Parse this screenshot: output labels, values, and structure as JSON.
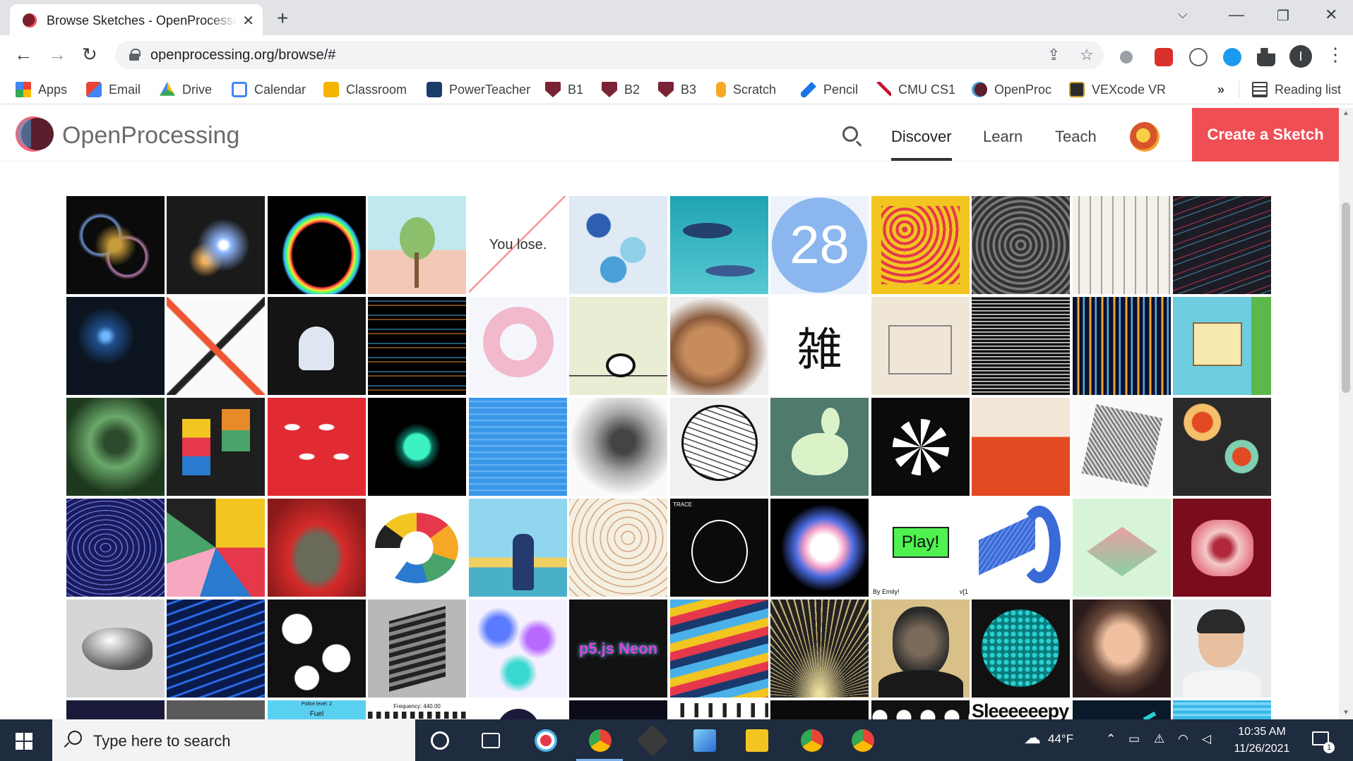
{
  "browser": {
    "tab_title": "Browse Sketches - OpenProcessing",
    "url": "openprocessing.org/browse/#",
    "profile_initial": "I"
  },
  "bookmarks": [
    {
      "label": "Apps",
      "icon": "apps-grid-icon"
    },
    {
      "label": "Email",
      "icon": "gmail-icon"
    },
    {
      "label": "Drive",
      "icon": "drive-icon"
    },
    {
      "label": "Calendar",
      "icon": "calendar-icon"
    },
    {
      "label": "Classroom",
      "icon": "classroom-icon"
    },
    {
      "label": "PowerTeacher",
      "icon": "sis-icon"
    },
    {
      "label": "B1",
      "icon": "shield-icon"
    },
    {
      "label": "B2",
      "icon": "shield-icon"
    },
    {
      "label": "B3",
      "icon": "shield-icon"
    },
    {
      "label": "Scratch",
      "icon": "scratch-icon"
    },
    {
      "label": "Pencil",
      "icon": "pencil-icon"
    },
    {
      "label": "CMU CS1",
      "icon": "cmu-icon"
    },
    {
      "label": "OpenProc",
      "icon": "openprocessing-icon"
    },
    {
      "label": "VEXcode VR",
      "icon": "vexcode-icon"
    }
  ],
  "bookmarks_overflow": "»",
  "reading_list": "Reading list",
  "site": {
    "brand": "OpenProcessing",
    "nav": [
      "Discover",
      "Learn",
      "Teach"
    ],
    "active_nav": "Discover",
    "create_button": "Create a Sketch"
  },
  "tile_texts": {
    "t4": "You lose.",
    "t7": "28",
    "t40": "Play!",
    "t40b": "By Emily!",
    "t41b": "v[1",
    "t37": "TRACE",
    "t54": "p5.js Neon",
    "t74": "Sleeeeeepy",
    "t62": "Police level: 2",
    "t62b": "Fuel",
    "t63": "Frequency: 440.00"
  },
  "colors": {
    "accent": "#f04e55",
    "taskbar": "#1f2b3e"
  },
  "taskbar": {
    "search_placeholder": "Type here to search",
    "weather": "44°F",
    "time": "10:35 AM",
    "date": "11/26/2021",
    "notifications": "1"
  }
}
